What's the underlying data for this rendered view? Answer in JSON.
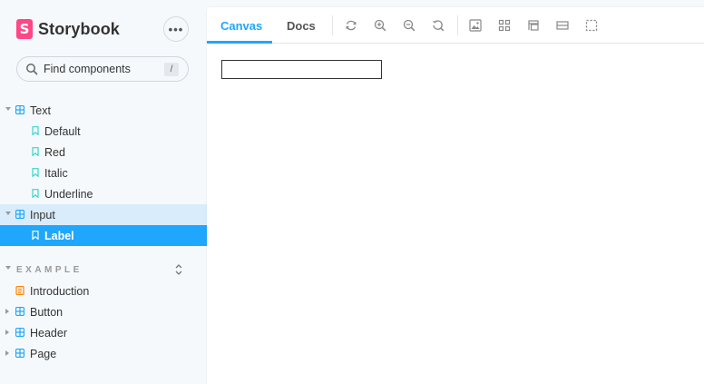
{
  "brand": {
    "logo_letter": "S",
    "name": "Storybook"
  },
  "menu": {
    "label": "•••"
  },
  "search": {
    "placeholder": "Find components",
    "shortcut": "/"
  },
  "tree": {
    "groups": [
      {
        "label": "Text",
        "stories": [
          "Default",
          "Red",
          "Italic",
          "Underline"
        ]
      },
      {
        "label": "Input",
        "stories": [
          "Label"
        ]
      }
    ],
    "section": {
      "title": "EXAMPLE",
      "items": [
        "Introduction",
        "Button",
        "Header",
        "Page"
      ]
    }
  },
  "toolbar": {
    "tabs": [
      "Canvas",
      "Docs"
    ],
    "active_tab": "Canvas",
    "tools": [
      "reload-icon",
      "zoom-in-icon",
      "zoom-out-icon",
      "zoom-reset-icon",
      "background-icon",
      "grid-icon",
      "viewport-icon",
      "measure-icon",
      "outline-icon"
    ]
  },
  "canvas": {
    "input_value": ""
  },
  "colors": {
    "accent": "#1ea7fd",
    "brand": "#ff4785",
    "component": "#1ea7fd",
    "story": "#37d5d3",
    "doc": "#ff8300"
  }
}
